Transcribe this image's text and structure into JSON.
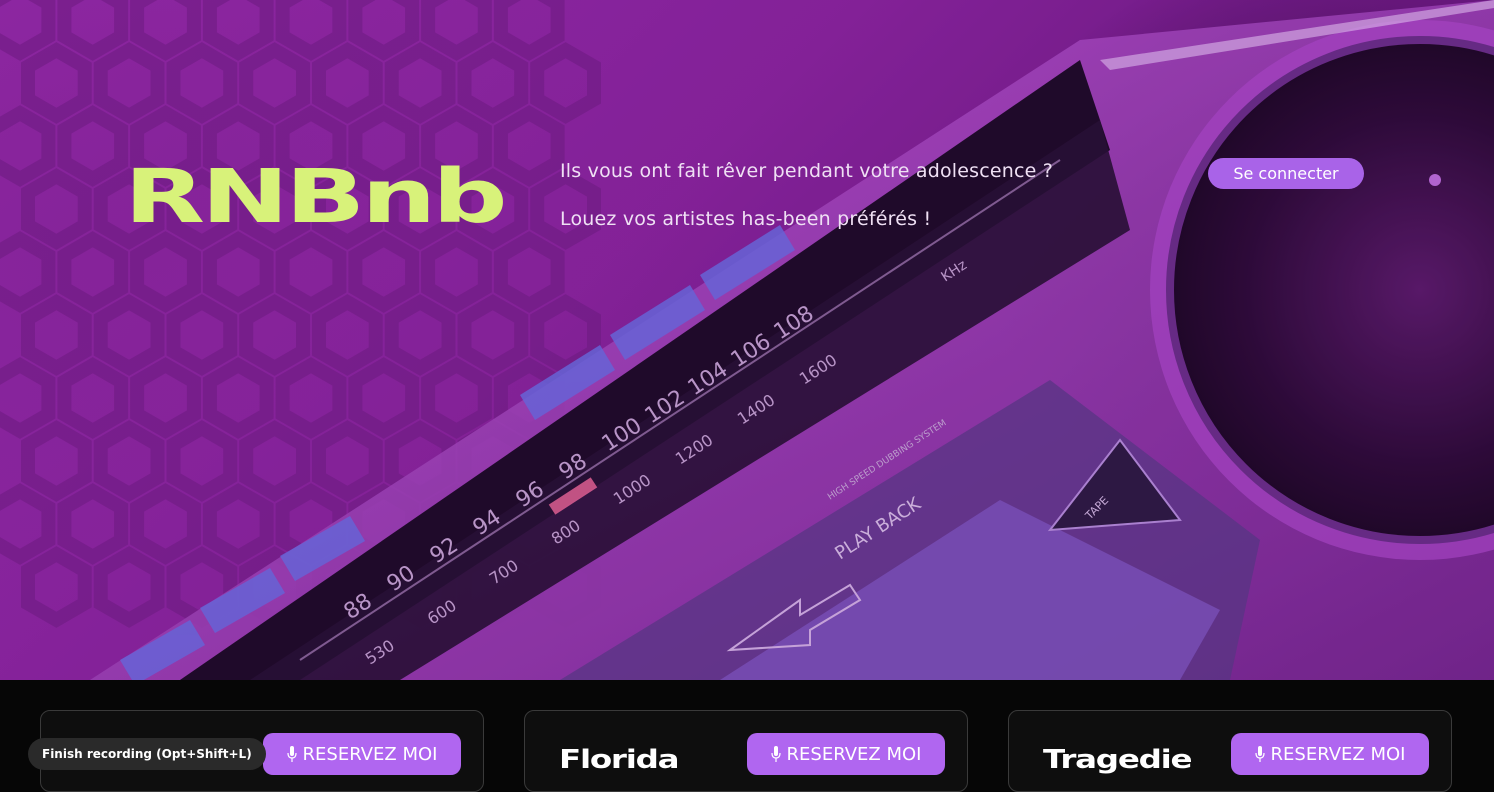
{
  "hero": {
    "logo": "RNBnb",
    "tagline_line1": "Ils vous ont fait rêver pendant votre adolescence ?",
    "tagline_line2": "Louez vos artistes has-been préférés !",
    "connect_label": "Se connecter"
  },
  "radio_dial": {
    "fm": [
      "88",
      "90",
      "92",
      "94",
      "96",
      "98",
      "100",
      "102",
      "104",
      "106",
      "108"
    ],
    "am": [
      "530",
      "600",
      "700",
      "800",
      "1000",
      "1200",
      "1400",
      "1600"
    ],
    "fm_unit": "KHz",
    "play_back": "PLAY BACK",
    "dubbing": "HIGH SPEED DUBBING SYSTEM",
    "tape": "TAPE"
  },
  "cards": [
    {
      "title": "",
      "button": "RESERVEZ MOI"
    },
    {
      "title": "Florida",
      "button": "RESERVEZ MOI"
    },
    {
      "title": "Tragedie",
      "button": "RESERVEZ MOI"
    }
  ],
  "recording_pill": "Finish recording (Opt+Shift+L)",
  "colors": {
    "logo": "#d8f27a",
    "accent_button": "#b066f0",
    "connect_button": "#a963e8",
    "hero_purple": "#9a2bb0",
    "background": "#060606"
  },
  "icons": [
    "microphone-icon"
  ]
}
